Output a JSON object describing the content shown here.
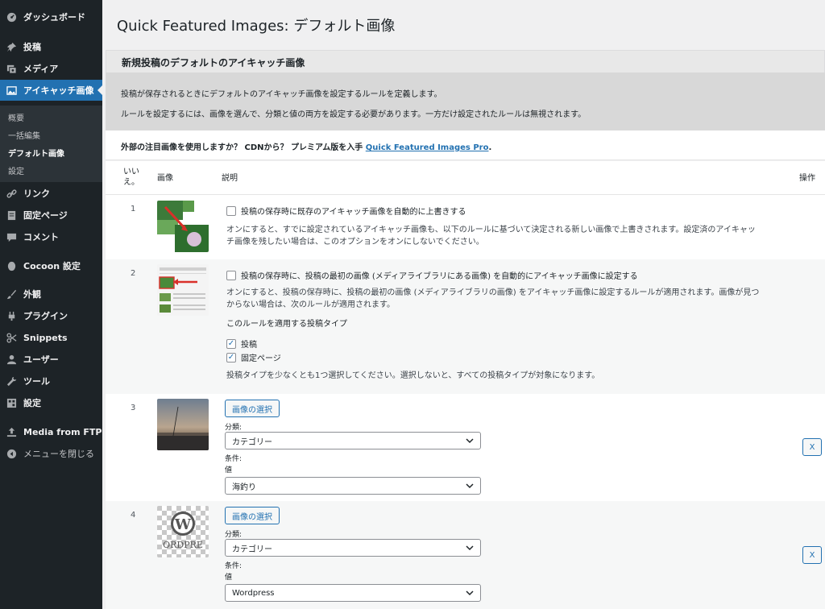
{
  "sidebar": {
    "dashboard": "ダッシュボード",
    "posts": "投稿",
    "media": "メディア",
    "featured": "アイキャッチ画像",
    "sub_overview": "概要",
    "sub_bulk": "一括編集",
    "sub_default": "デフォルト画像",
    "sub_settings": "設定",
    "links": "リンク",
    "pages": "固定ページ",
    "comments": "コメント",
    "cocoon": "Cocoon 設定",
    "appearance": "外観",
    "plugins": "プラグイン",
    "snippets": "Snippets",
    "users": "ユーザー",
    "tools": "ツール",
    "settings": "設定",
    "media_ftp": "Media from FTP",
    "collapse": "メニューを閉じる"
  },
  "page_title": "Quick Featured Images: デフォルト画像",
  "section_title": "新規投稿のデフォルトのアイキャッチ画像",
  "desc_line1": "投稿が保存されるときにデフォルトのアイキャッチ画像を設定するルールを定義します。",
  "desc_line2": "ルールを設定するには、画像を選んで、分類と値の両方を設定する必要があります。一方だけ設定されたルールは無視されます。",
  "promo_text": "外部の注目画像を使用しますか？ CDNから？ プレミアム版を入手",
  "promo_link": "Quick Featured Images Pro",
  "promo_end": ".",
  "table": {
    "col_no": "いいえ。",
    "col_no_l1": "いい",
    "col_no_l2": "え。",
    "col_image": "画像",
    "col_desc": "説明",
    "col_action": "操作"
  },
  "rule1": {
    "num": "1",
    "checkbox_label": "投稿の保存時に既存のアイキャッチ画像を自動的に上書きする",
    "desc_l1": "オンにすると、すでに設定されているアイキャッチ画像も、以下のルールに基づいて決定される新しい画像で上書きされます。設定済のアイキャッ",
    "desc_l2": "チ画像を残したい場合は、このオプションをオンにしないでください。"
  },
  "rule2": {
    "num": "2",
    "checkbox_label": "投稿の保存時に、投稿の最初の画像 (メディアライブラリにある画像) を自動的にアイキャッチ画像に設定する",
    "desc_l1": "オンにすると、投稿の保存時に、投稿の最初の画像 (メディアライブラリの画像) をアイキャッチ画像に設定するルールが適用されます。画像が見つ",
    "desc_l2": "からない場合は、次のルールが適用されます。",
    "post_types_label": "このルールを適用する投稿タイプ",
    "type_post": "投稿",
    "type_page": "固定ページ",
    "note": "投稿タイプを少なくとも1つ選択してください。選択しないと、すべての投稿タイプが対象になります。"
  },
  "rule3": {
    "num": "3",
    "select_image": "画像の選択",
    "taxonomy_label": "分類:",
    "taxonomy_value": "カテゴリー",
    "condition_label": "条件:",
    "value_label": "値",
    "value_value": "海釣り",
    "remove": "X"
  },
  "rule4": {
    "num": "4",
    "select_image": "画像の選択",
    "taxonomy_label": "分類:",
    "taxonomy_value": "カテゴリー",
    "condition_label": "条件:",
    "value_label": "値",
    "value_value": "Wordpress",
    "remove": "X",
    "thumb_text": "ORDPRE"
  },
  "colors": {
    "sidebar_bg": "#1d2327",
    "accent": "#2271b1",
    "page_bg": "#f0f0f1"
  }
}
